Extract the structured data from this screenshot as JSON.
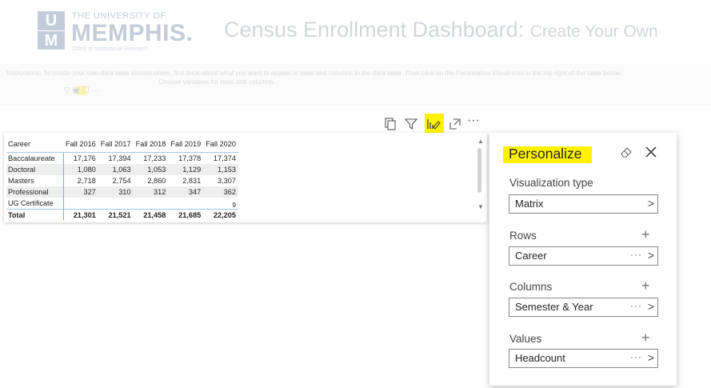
{
  "header": {
    "logo": {
      "mark_top": "U",
      "mark_bottom": "M",
      "the_university_of": "THE UNIVERSITY OF",
      "name": "MEMPHIS.",
      "sub": "Office of Institutional Research"
    },
    "title": "Census Enrollment Dashboard:",
    "title_suffix": "Create Your Own"
  },
  "instructions": {
    "text": "Instructions: To create your own data table visualizations, first think about what you want to appear in rows and columns in the data table. Then click on the Personalize Visual icon in the top right of the table below.",
    "icons": "▽  ▣  ☐  ···",
    "tail": "Choose variables for rows and columns."
  },
  "toolbar": {
    "icons": [
      "copy-icon",
      "filter-icon",
      "personalize-visual-icon",
      "focus-mode-icon",
      "more-options-icon"
    ],
    "more": "···"
  },
  "matrix": {
    "columns": [
      "Career",
      "Fall 2016",
      "Fall 2017",
      "Fall 2018",
      "Fall 2019",
      "Fall 2020"
    ],
    "rows": [
      {
        "label": "Baccalaureate",
        "values": [
          "17,176",
          "17,394",
          "17,233",
          "17,378",
          "17,374"
        ]
      },
      {
        "label": "Doctoral",
        "values": [
          "1,080",
          "1,063",
          "1,053",
          "1,129",
          "1,153"
        ]
      },
      {
        "label": "Masters",
        "values": [
          "2,718",
          "2,754",
          "2,860",
          "2,831",
          "3,307"
        ]
      },
      {
        "label": "Professional",
        "values": [
          "327",
          "310",
          "312",
          "347",
          "362"
        ]
      },
      {
        "label": "UG Certificate",
        "values": [
          "",
          "",
          "",
          "",
          "9"
        ]
      }
    ],
    "total": {
      "label": "Total",
      "values": [
        "21,301",
        "21,521",
        "21,458",
        "21,685",
        "22,205"
      ]
    }
  },
  "pane": {
    "title": "Personalize",
    "visualization_type": {
      "label": "Visualization type",
      "value": "Matrix"
    },
    "rows": {
      "label": "Rows",
      "value": "Career"
    },
    "columns": {
      "label": "Columns",
      "value": "Semester & Year"
    },
    "values": {
      "label": "Values",
      "value": "Headcount"
    },
    "plus": "+",
    "dots": "···",
    "chevron": ">"
  },
  "colors": {
    "highlight": "#fff200",
    "accent_line": "#69b0e6"
  }
}
